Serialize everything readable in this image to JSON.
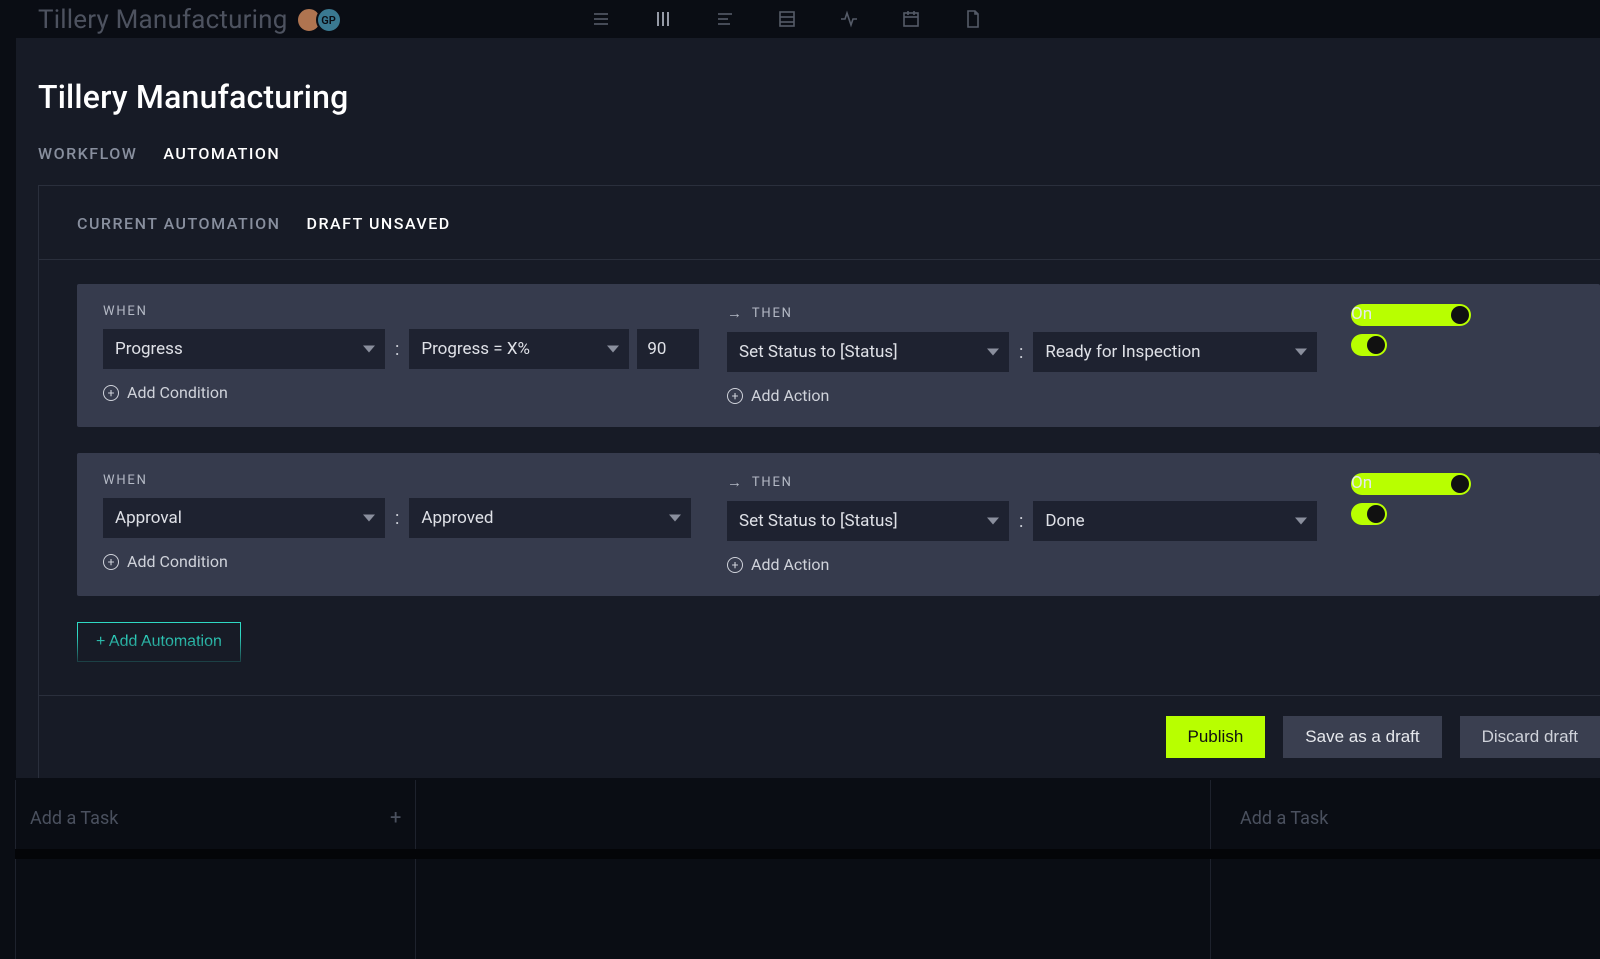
{
  "bg": {
    "title": "Tillery Manufacturing",
    "avatar2": "GP",
    "addTask": "Add a Task"
  },
  "panel": {
    "title": "Tillery Manufacturing",
    "tabs": {
      "workflow": "WORKFLOW",
      "automation": "AUTOMATION"
    },
    "subtabs": {
      "current": "CURRENT AUTOMATION",
      "draft": "DRAFT UNSAVED"
    },
    "labels": {
      "when": "WHEN",
      "then": "THEN",
      "addCondition": "Add Condition",
      "addAction": "Add Action",
      "on": "On",
      "addAutomation": "+ Add Automation"
    },
    "rules": [
      {
        "when": {
          "field": "Progress",
          "op": "Progress = X%",
          "value": "90"
        },
        "then": {
          "action": "Set Status to [Status]",
          "value": "Ready for Inspection"
        },
        "enabled": true
      },
      {
        "when": {
          "field": "Approval",
          "op": "Approved",
          "value": ""
        },
        "then": {
          "action": "Set Status to [Status]",
          "value": "Done"
        },
        "enabled": true
      }
    ],
    "footer": {
      "publish": "Publish",
      "saveDraft": "Save as a draft",
      "discard": "Discard draft"
    }
  }
}
